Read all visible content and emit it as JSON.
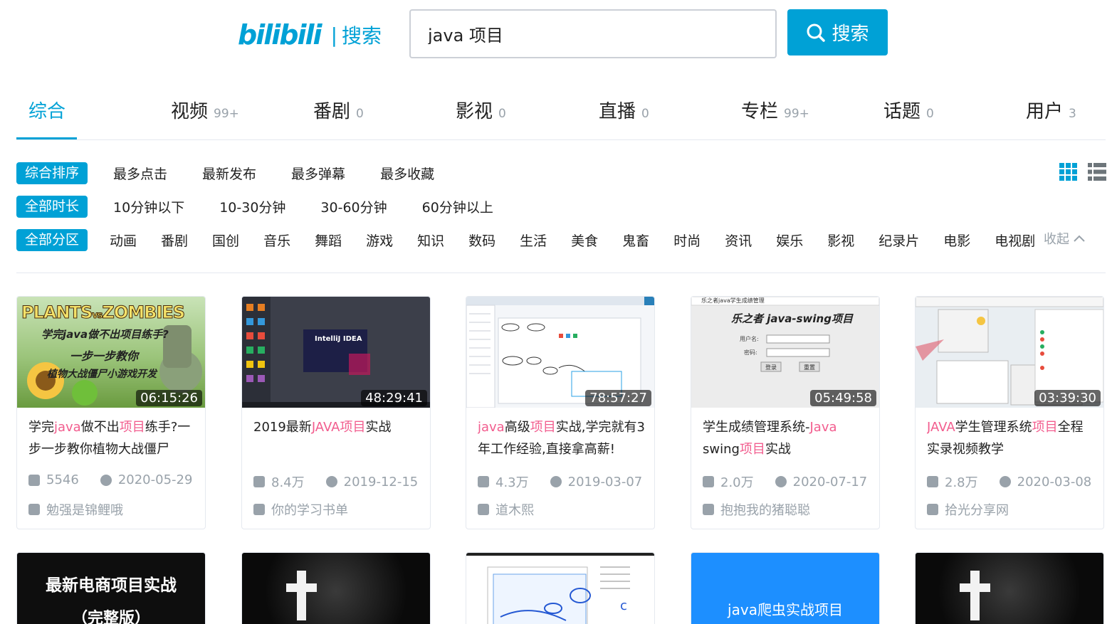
{
  "header": {
    "logo_brand": "bilibili",
    "logo_sep": "|",
    "logo_label": "搜索",
    "search_value": "java 项目",
    "search_button": "搜索"
  },
  "tabs": [
    {
      "label": "综合",
      "count": ""
    },
    {
      "label": "视频",
      "count": "99+"
    },
    {
      "label": "番剧",
      "count": "0"
    },
    {
      "label": "影视",
      "count": "0"
    },
    {
      "label": "直播",
      "count": "0"
    },
    {
      "label": "专栏",
      "count": "99+"
    },
    {
      "label": "话题",
      "count": "0"
    },
    {
      "label": "用户",
      "count": "3"
    }
  ],
  "filters": {
    "order": {
      "selected": "综合排序",
      "options": [
        "最多点击",
        "最新发布",
        "最多弹幕",
        "最多收藏"
      ]
    },
    "duration": {
      "selected": "全部时长",
      "options": [
        "10分钟以下",
        "10-30分钟",
        "30-60分钟",
        "60分钟以上"
      ]
    },
    "zone": {
      "selected": "全部分区",
      "options": [
        "动画",
        "番剧",
        "国创",
        "音乐",
        "舞蹈",
        "游戏",
        "知识",
        "数码",
        "生活",
        "美食",
        "鬼畜",
        "时尚",
        "资讯",
        "娱乐",
        "影视",
        "纪录片",
        "电影",
        "电视剧"
      ]
    },
    "collapse": "收起"
  },
  "videos": [
    {
      "duration": "06:15:26",
      "title": [
        [
          "学完",
          0
        ],
        [
          "java",
          1
        ],
        [
          "做不出",
          0
        ],
        [
          "项目",
          1
        ],
        [
          "练手?一步一步教你植物大战僵尸",
          0
        ]
      ],
      "plays": "5546",
      "date": "2020-05-29",
      "uploader": "勉强是锦鲤哦",
      "thumb_text": [
        "PLANTS",
        "vs",
        "ZOMBIES",
        "学完java做不出项目练手?",
        "一步一步教你",
        "植物大战僵尸小游戏开发"
      ]
    },
    {
      "duration": "48:29:41",
      "title": [
        [
          "2019最新",
          0
        ],
        [
          "JAVA",
          1
        ],
        [
          "项目",
          1
        ],
        [
          "实战",
          0
        ]
      ],
      "plays": "8.4万",
      "date": "2019-12-15",
      "uploader": "你的学习书单",
      "thumb_text": [
        "IntelliJ IDEA"
      ]
    },
    {
      "duration": "78:57:27",
      "title": [
        [
          "java",
          1
        ],
        [
          "高级",
          0
        ],
        [
          "项目",
          1
        ],
        [
          "实战,学完就有3年工作经验,直接拿高薪!",
          0
        ]
      ],
      "plays": "4.3万",
      "date": "2019-03-07",
      "uploader": "道木熙",
      "thumb_text": []
    },
    {
      "duration": "05:49:58",
      "title": [
        [
          "学生成绩管理系统-",
          0
        ],
        [
          "Java",
          1
        ],
        [
          " swing",
          0
        ],
        [
          "项目",
          1
        ],
        [
          "实战",
          0
        ]
      ],
      "plays": "2.0万",
      "date": "2020-07-17",
      "uploader": "抱抱我的猪聪聪",
      "thumb_text": [
        "乐之者java学生成绩管理",
        "乐之者 java-swing项目",
        "用户名:",
        "密码:",
        "登录",
        "重置"
      ]
    },
    {
      "duration": "03:39:30",
      "title": [
        [
          "JAVA",
          1
        ],
        [
          "学生管理系统",
          0
        ],
        [
          "项目",
          1
        ],
        [
          "全程实录视频教学",
          0
        ]
      ],
      "plays": "2.8万",
      "date": "2020-03-08",
      "uploader": "拾光分享网",
      "thumb_text": []
    }
  ],
  "second_row": [
    {
      "thumb_text": [
        "最新电商项目实战",
        "（完整版）"
      ]
    },
    {
      "thumb_text": []
    },
    {
      "thumb_text": []
    },
    {
      "thumb_text": [
        "java爬虫实战项目"
      ]
    },
    {
      "thumb_text": []
    }
  ],
  "colors": {
    "accent": "#00a1d6",
    "keyword": "#f25d8e",
    "muted": "#99a2aa",
    "border": "#e5e9ef"
  }
}
